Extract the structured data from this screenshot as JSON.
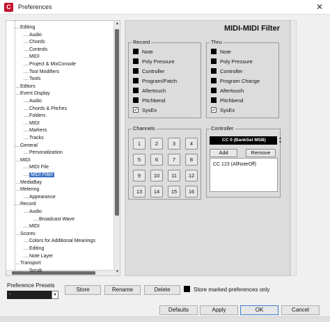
{
  "window": {
    "title": "Preferences",
    "app_icon_glyph": "C",
    "close_glyph": "✕"
  },
  "tree": {
    "items": [
      {
        "label": "Editing",
        "level": 1
      },
      {
        "label": "Audio",
        "level": 2
      },
      {
        "label": "Chords",
        "level": 2
      },
      {
        "label": "Controls",
        "level": 2
      },
      {
        "label": "MIDI",
        "level": 2
      },
      {
        "label": "Project & MixConsole",
        "level": 2
      },
      {
        "label": "Tool Modifiers",
        "level": 2
      },
      {
        "label": "Tools",
        "level": 2
      },
      {
        "label": "Editors",
        "level": 1
      },
      {
        "label": "Event Display",
        "level": 1
      },
      {
        "label": "Audio",
        "level": 2
      },
      {
        "label": "Chords & Pitches",
        "level": 2
      },
      {
        "label": "Folders",
        "level": 2
      },
      {
        "label": "MIDI",
        "level": 2
      },
      {
        "label": "Markers",
        "level": 2
      },
      {
        "label": "Tracks",
        "level": 2
      },
      {
        "label": "General",
        "level": 1
      },
      {
        "label": "Personalization",
        "level": 2
      },
      {
        "label": "MIDI",
        "level": 1
      },
      {
        "label": "MIDI File",
        "level": 2
      },
      {
        "label": "MIDI Filter",
        "level": 2,
        "selected": true
      },
      {
        "label": "MediaBay",
        "level": 1
      },
      {
        "label": "Metering",
        "level": 1
      },
      {
        "label": "Appearance",
        "level": 2
      },
      {
        "label": "Record",
        "level": 1
      },
      {
        "label": "Audio",
        "level": 2
      },
      {
        "label": "Broadcast Wave",
        "level": 3
      },
      {
        "label": "MIDI",
        "level": 2
      },
      {
        "label": "Scores",
        "level": 1
      },
      {
        "label": "Colors for Additional Meanings",
        "level": 2
      },
      {
        "label": "Editing",
        "level": 2
      },
      {
        "label": "Note Layer",
        "level": 2
      },
      {
        "label": "Transport",
        "level": 1
      },
      {
        "label": "Scrub",
        "level": 2
      }
    ]
  },
  "main": {
    "title": "MIDI-MIDI Filter",
    "record": {
      "label": "Record",
      "items": [
        {
          "label": "Note",
          "checked": false
        },
        {
          "label": "Poly Pressure",
          "checked": false
        },
        {
          "label": "Controller",
          "checked": false
        },
        {
          "label": "Program/Patch",
          "checked": false
        },
        {
          "label": "Aftertouch",
          "checked": false
        },
        {
          "label": "Pitchbend",
          "checked": false
        },
        {
          "label": "SysEx",
          "checked": true
        }
      ]
    },
    "thru": {
      "label": "Thru",
      "items": [
        {
          "label": "Note",
          "checked": false
        },
        {
          "label": "Poly Pressure",
          "checked": false
        },
        {
          "label": "Controller",
          "checked": false
        },
        {
          "label": "Program Change",
          "checked": false
        },
        {
          "label": "Aftertouch",
          "checked": false
        },
        {
          "label": "Pitchbend",
          "checked": false
        },
        {
          "label": "SysEx",
          "checked": true
        }
      ]
    },
    "channels": {
      "label": "Channels",
      "buttons": [
        "1",
        "2",
        "3",
        "4",
        "5",
        "6",
        "7",
        "8",
        "9",
        "10",
        "11",
        "12",
        "13",
        "14",
        "15",
        "16"
      ]
    },
    "controller": {
      "label": "Controller",
      "selected": "CC 0  (BankSel MSB)",
      "add_label": "Add",
      "remove_label": "Remove",
      "list": [
        "CC 123  (AllNoteOff)"
      ]
    }
  },
  "presets": {
    "label": "Preference Presets",
    "combo_value": "-",
    "store_label": "Store",
    "rename_label": "Rename",
    "delete_label": "Delete",
    "store_marked_label": "Store marked preferences only"
  },
  "footer": {
    "defaults_label": "Defaults",
    "apply_label": "Apply",
    "ok_label": "OK",
    "cancel_label": "Cancel"
  },
  "colors": {
    "selection": "#3b73c4",
    "primary_border": "#3c7fd6",
    "app_icon": "#c8102e"
  }
}
